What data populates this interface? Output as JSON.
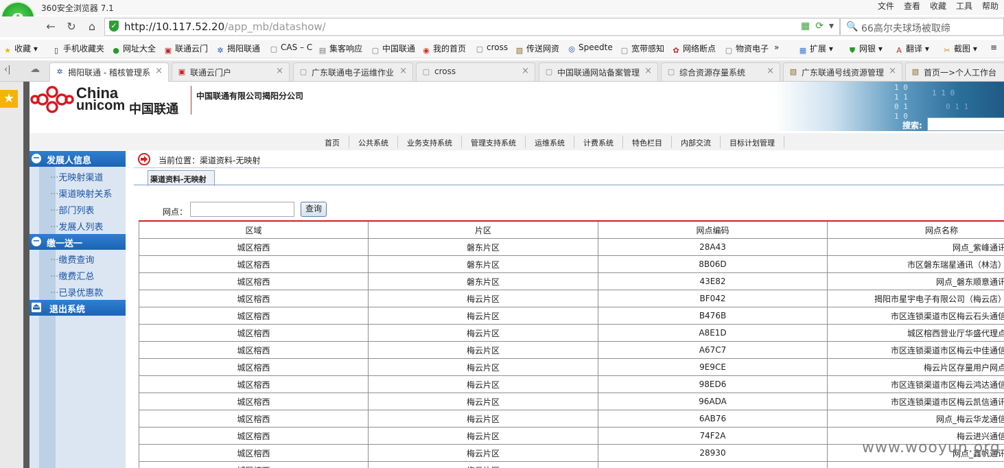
{
  "browser": {
    "title": "360安全浏览器 7.1",
    "menu": [
      "文件",
      "查看",
      "收藏",
      "工具",
      "帮助"
    ],
    "address_host": "http://10.117.52.20",
    "address_path": "/app_mb/datashow/",
    "search_text": "66高尔夫球场被取缔",
    "bookmarks": [
      "收藏",
      "手机收藏夹",
      "网址大全",
      "联通云门",
      "揭阳联通",
      "CAS – C",
      "集客响应",
      "中国联通",
      "我的首页",
      "cross",
      "传送网资",
      "Speedte",
      "宽带感知",
      "网络断点",
      "物资电子",
      "扩展",
      "网银",
      "翻译",
      "截图"
    ],
    "tabs": [
      {
        "label": "揭阳联通 - 稽核管理系",
        "active": true
      },
      {
        "label": "联通云门户",
        "active": false
      },
      {
        "label": "广东联通电子运维作业",
        "active": false
      },
      {
        "label": "cross",
        "active": false
      },
      {
        "label": "中国联通网站备案管理",
        "active": false
      },
      {
        "label": "综合资源存量系统",
        "active": false
      },
      {
        "label": "广东联通号线资源管理",
        "active": false
      },
      {
        "label": "首页一>个人工作台",
        "active": false
      }
    ]
  },
  "header": {
    "brand_en_1": "China",
    "brand_en_2": "unicom",
    "brand_cn": "中国联通",
    "company": "中国联通有限公司揭阳分公司",
    "search_label": "搜索:"
  },
  "topnav": [
    "首页",
    "公共系统",
    "业务支持系统",
    "管理支持系统",
    "运维系统",
    "计费系统",
    "特色栏目",
    "内部交流",
    "目标计划管理"
  ],
  "sidebar": {
    "groups": [
      {
        "title": "发展人信息",
        "items": [
          "无映射渠道",
          "渠道映射关系",
          "部门列表",
          "发展人列表"
        ]
      },
      {
        "title": "缴一送一",
        "items": [
          "缴费查询",
          "缴费汇总",
          "已录优惠款"
        ]
      },
      {
        "title": "退出系统",
        "items": []
      }
    ]
  },
  "content": {
    "location": "当前位置：渠道资料-无映射",
    "subtab": "渠道资料-无映射",
    "query_label": "网点：",
    "query_value": "",
    "query_button": "查询",
    "table": {
      "headers": [
        "区域",
        "片区",
        "网点编码",
        "网点名称"
      ],
      "rows": [
        [
          "城区榕西",
          "磐东片区",
          "28A43",
          "网点_紫峰通讯"
        ],
        [
          "城区榕西",
          "磐东片区",
          "8B06D",
          "市区磐东瑞星通讯（林洁）"
        ],
        [
          "城区榕西",
          "磐东片区",
          "43E82",
          "网点_磐东顺意通讯"
        ],
        [
          "城区榕西",
          "梅云片区",
          "BF042",
          "揭阳市星宇电子有限公司（梅云店）"
        ],
        [
          "城区榕西",
          "梅云片区",
          "B476B",
          "市区连锁渠道市区梅云石头通信"
        ],
        [
          "城区榕西",
          "梅云片区",
          "A8E1D",
          "城区榕西营业厅华盛代理点"
        ],
        [
          "城区榕西",
          "梅云片区",
          "A67C7",
          "市区连锁渠道市区梅云中佳通信"
        ],
        [
          "城区榕西",
          "梅云片区",
          "9E9CE",
          "梅云片区存量用户网点"
        ],
        [
          "城区榕西",
          "梅云片区",
          "98ED6",
          "市区连锁渠道市区梅云鸿达通信"
        ],
        [
          "城区榕西",
          "梅云片区",
          "96ADA",
          "市区连锁渠道市区梅云凯信通讯"
        ],
        [
          "城区榕西",
          "梅云片区",
          "6AB76",
          "网点_梅云华龙通信"
        ],
        [
          "城区榕西",
          "梅云片区",
          "74F2A",
          "梅云进兴通信"
        ],
        [
          "城区榕西",
          "梅云片区",
          "28930",
          "网点_鑫帆通讯"
        ],
        [
          "城区榕西",
          "梅云片区",
          "",
          ""
        ]
      ]
    }
  },
  "watermark": "www.wooyun.org"
}
